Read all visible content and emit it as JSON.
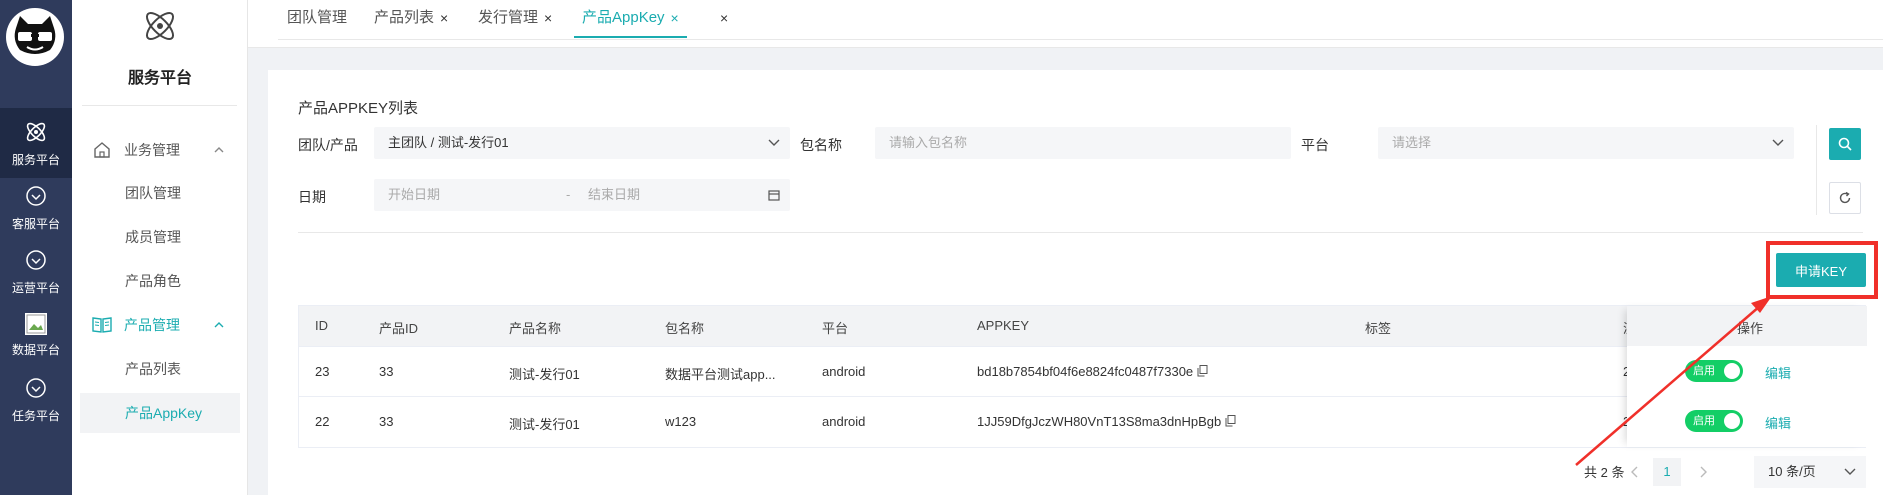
{
  "rail": {
    "items": [
      {
        "label": "服务平台",
        "icon": "atom-icon"
      },
      {
        "label": "客服平台",
        "icon": "chevron-circle-icon"
      },
      {
        "label": "运营平台",
        "icon": "chevron-circle-icon"
      },
      {
        "label": "数据平台",
        "icon": "broken-image-icon"
      },
      {
        "label": "任务平台",
        "icon": "chevron-circle-icon"
      }
    ]
  },
  "sidebar": {
    "brand": "服务平台",
    "group1": "业务管理",
    "group1_items": [
      "团队管理",
      "成员管理",
      "产品角色"
    ],
    "group2": "产品管理",
    "group2_items": [
      "产品列表",
      "产品AppKey"
    ]
  },
  "tabs": [
    "团队管理",
    "产品列表",
    "发行管理",
    "产品AppKey"
  ],
  "tab_close": "×",
  "page": {
    "title": "产品APPKEY列表",
    "team_label": "团队/产品",
    "team_value": "主团队 / 测试-发行01",
    "pkg_label": "包名称",
    "pkg_placeholder": "请输入包名称",
    "platform_label": "平台",
    "platform_placeholder": "请选择",
    "date_label": "日期",
    "date_start": "开始日期",
    "date_sep": "-",
    "date_end": "结束日期",
    "apply_button": "申请KEY"
  },
  "table": {
    "headers": [
      "ID",
      "产品ID",
      "产品名称",
      "包名称",
      "平台",
      "APPKEY",
      "标签",
      "操作"
    ],
    "header_cut": "济",
    "rows": [
      {
        "id": "23",
        "product_id": "33",
        "product_name": "测试-发行01",
        "package": "数据平台测试app...",
        "platform": "android",
        "appkey": "bd18b7854bf04f6e8824fc0487f7330e",
        "cut": "2",
        "status": "启用",
        "edit": "编辑"
      },
      {
        "id": "22",
        "product_id": "33",
        "product_name": "测试-发行01",
        "package": "w123",
        "platform": "android",
        "appkey": "1JJ59DfgJczWH80VnT13S8ma3dnHpBgb",
        "cut": "2",
        "status": "启用",
        "edit": "编辑"
      }
    ]
  },
  "pagination": {
    "total": "共 2 条",
    "current": "1",
    "page_size": "10 条/页"
  },
  "colors": {
    "accent": "#1bacb0",
    "rail": "#2f3b5c",
    "toggle_on": "#13ce66",
    "annotation": "#f0302a"
  }
}
